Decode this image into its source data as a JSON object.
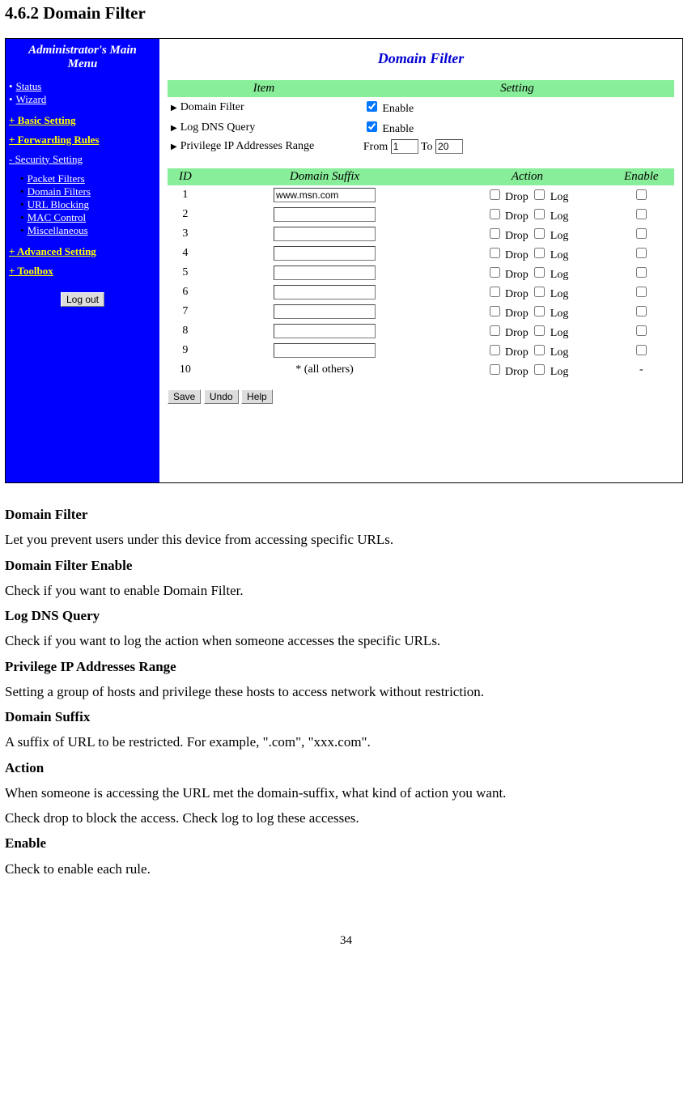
{
  "section_heading": "4.6.2 Domain Filter",
  "sidebar": {
    "title_line1": "Administrator's Main",
    "title_line2": "Menu",
    "top_links": [
      "Status",
      "Wizard"
    ],
    "basic": "+ Basic Setting",
    "forwarding": "+ Forwarding Rules",
    "security": "- Security Setting",
    "security_items": [
      "Packet Filters",
      "Domain Filters",
      "URL Blocking",
      "MAC Control",
      "Miscellaneous"
    ],
    "advanced": "+ Advanced Setting",
    "toolbox": "+ Toolbox",
    "logout": "Log out"
  },
  "content": {
    "title": "Domain Filter",
    "headers": {
      "item": "Item",
      "setting": "Setting"
    },
    "rows": {
      "domain_filter": {
        "label": "Domain Filter",
        "enable_label": "Enable",
        "checked": true
      },
      "log_dns": {
        "label": "Log DNS Query",
        "enable_label": "Enable",
        "checked": true
      },
      "priv_ip": {
        "label": "Privilege IP Addresses Range",
        "from_label": "From",
        "to_label": "To",
        "from_val": "1",
        "to_val": "20"
      }
    },
    "rule_headers": {
      "id": "ID",
      "suffix": "Domain Suffix",
      "action": "Action",
      "enable": "Enable"
    },
    "action_labels": {
      "drop": "Drop",
      "log": "Log"
    },
    "rules": [
      {
        "id": "1",
        "suffix": "www.msn.com",
        "has_input": true,
        "has_enable": true
      },
      {
        "id": "2",
        "suffix": "",
        "has_input": true,
        "has_enable": true
      },
      {
        "id": "3",
        "suffix": "",
        "has_input": true,
        "has_enable": true
      },
      {
        "id": "4",
        "suffix": "",
        "has_input": true,
        "has_enable": true
      },
      {
        "id": "5",
        "suffix": "",
        "has_input": true,
        "has_enable": true
      },
      {
        "id": "6",
        "suffix": "",
        "has_input": true,
        "has_enable": true
      },
      {
        "id": "7",
        "suffix": "",
        "has_input": true,
        "has_enable": true
      },
      {
        "id": "8",
        "suffix": "",
        "has_input": true,
        "has_enable": true
      },
      {
        "id": "9",
        "suffix": "",
        "has_input": true,
        "has_enable": true
      },
      {
        "id": "10",
        "suffix": "* (all others)",
        "has_input": false,
        "has_enable": false
      }
    ],
    "buttons": {
      "save": "Save",
      "undo": "Undo",
      "help": "Help"
    }
  },
  "docs": {
    "t1": "Domain Filter",
    "p1": "Let you prevent users under this device from accessing specific URLs.",
    "t2": "Domain Filter Enable",
    "p2": "Check if you want to enable Domain Filter.",
    "t3": "Log DNS Query",
    "p3": "Check if you want to log the action when someone accesses the specific URLs.",
    "t4": "Privilege IP Addresses Range",
    "p4": "Setting a group of hosts and privilege these hosts to access network without restriction.",
    "t5": "Domain Suffix",
    "p5": "A suffix of URL to be restricted. For example, \".com\", \"xxx.com\".",
    "t6": "Action",
    "p6a": "When someone is accessing the URL met the domain-suffix, what kind of action you want.",
    "p6b": "Check drop to block the access. Check log to log these accesses.",
    "t7": "Enable",
    "p7": "Check to enable each rule."
  },
  "page_number": "34"
}
